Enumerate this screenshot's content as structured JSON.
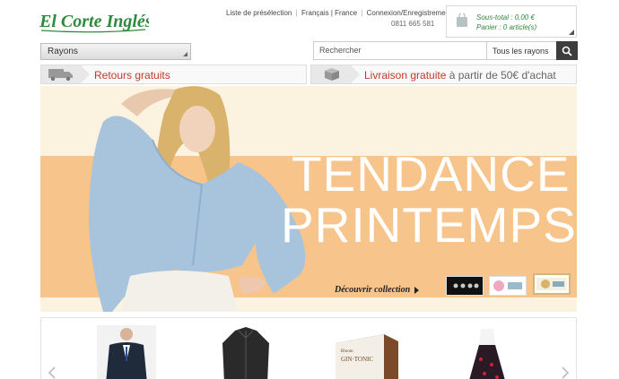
{
  "header": {
    "logo_text": "El Corte Inglés",
    "links": [
      "Liste de présélection",
      "Français | France",
      "Connexion/Enregistrement"
    ],
    "phone": "0811 665 581",
    "cart": {
      "subtotal": "Sous-total : 0,00 €",
      "items": "Panier : 0 article(s)"
    }
  },
  "search": {
    "departments_label": "Rayons",
    "placeholder": "Rechercher",
    "scope_label": "Tous les rayons"
  },
  "promos": {
    "returns": "Retours gratuits",
    "delivery_highlight": "Livraison gratuite",
    "delivery_rest": " à partir de 50€ d'achat"
  },
  "hero": {
    "line1": "TENDANCE",
    "line2": "PRINTEMPS",
    "cta": "Découvrir collection"
  },
  "colors": {
    "brand_green": "#2e8b3c",
    "promo_red": "#c0392b",
    "hero_band": "#f7c48b"
  }
}
